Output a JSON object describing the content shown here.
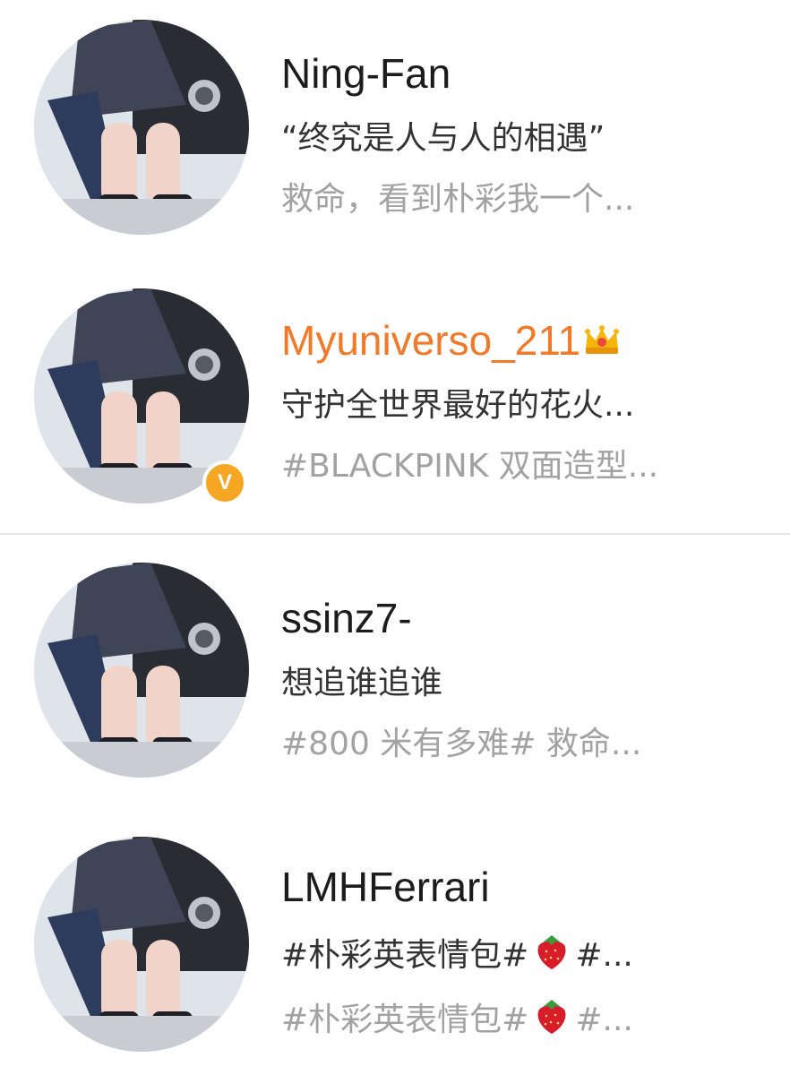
{
  "users": [
    {
      "username": "Ning-Fan",
      "bio": "“终究是人与人的相遇”",
      "latest": "救命，看到朴彩我一个...",
      "verified": false,
      "vip": false
    },
    {
      "username": "Myuniverso_211",
      "bio": "守护全世界最好的花火...",
      "latest": "#BLACKPINK 双面造型...",
      "verified": true,
      "vip": true,
      "badge_label": "V",
      "name_color": "#f07a2a"
    },
    {
      "username": "ssinz7-",
      "bio": "想追谁追谁",
      "latest": "#800 米有多难# 救命...",
      "verified": false,
      "vip": false
    },
    {
      "username": "LMHFerrari",
      "bio_prefix": "#朴彩英表情包#",
      "bio_suffix": "#...",
      "latest_prefix": "#朴彩英表情包#",
      "latest_suffix": "#...",
      "verified": false,
      "vip": false
    }
  ],
  "icons": {
    "avatar": "avatar-photo",
    "verified": "verified-badge-icon",
    "crown": "crown-icon",
    "emoji": "strawberry-icon"
  }
}
